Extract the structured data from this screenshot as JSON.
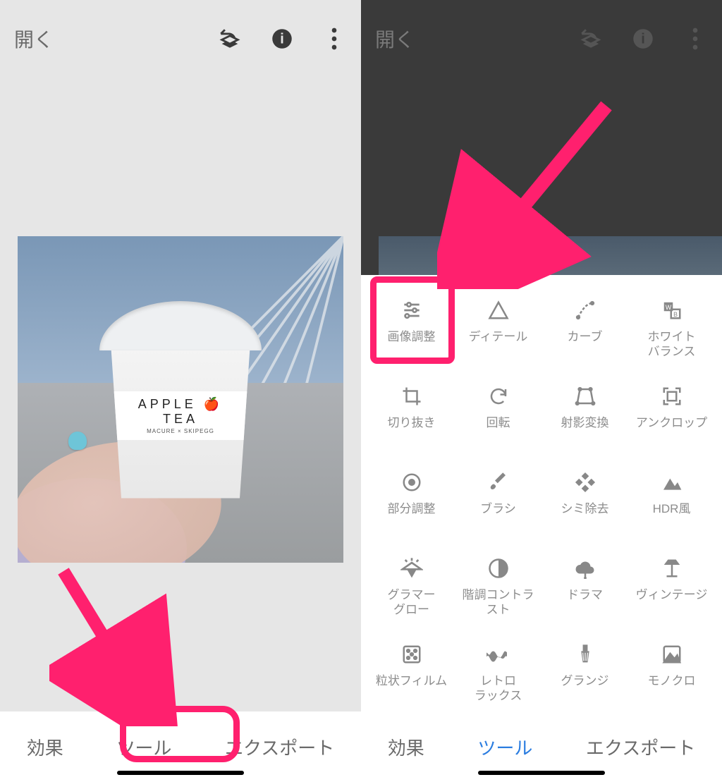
{
  "left": {
    "open": "開く",
    "photo": {
      "cup_text1": "APPLE 🍎 TEA",
      "cup_text2": "MACURE × SKIPEGG"
    },
    "nav": {
      "effects": "効果",
      "tools": "ツール",
      "export": "エクスポート"
    }
  },
  "right": {
    "open": "開く",
    "tools": [
      {
        "label": "画像調整",
        "icon": "tune"
      },
      {
        "label": "ディテール",
        "icon": "detail"
      },
      {
        "label": "カーブ",
        "icon": "curve"
      },
      {
        "label": "ホワイト\nバランス",
        "icon": "wb"
      },
      {
        "label": "切り抜き",
        "icon": "crop"
      },
      {
        "label": "回転",
        "icon": "rotate"
      },
      {
        "label": "射影変換",
        "icon": "perspective"
      },
      {
        "label": "アンクロップ",
        "icon": "uncrop"
      },
      {
        "label": "部分調整",
        "icon": "selective"
      },
      {
        "label": "ブラシ",
        "icon": "brush"
      },
      {
        "label": "シミ除去",
        "icon": "heal"
      },
      {
        "label": "HDR風",
        "icon": "hdr"
      },
      {
        "label": "グラマー\nグロー",
        "icon": "glow"
      },
      {
        "label": "階調コントラ\nスト",
        "icon": "tonal"
      },
      {
        "label": "ドラマ",
        "icon": "drama"
      },
      {
        "label": "ヴィンテージ",
        "icon": "vintage"
      },
      {
        "label": "粒状フィルム",
        "icon": "grain"
      },
      {
        "label": "レトロ\nラックス",
        "icon": "retrolux"
      },
      {
        "label": "グランジ",
        "icon": "grunge"
      },
      {
        "label": "モノクロ",
        "icon": "mono"
      }
    ],
    "nav": {
      "effects": "効果",
      "tools": "ツール",
      "export": "エクスポート"
    }
  }
}
